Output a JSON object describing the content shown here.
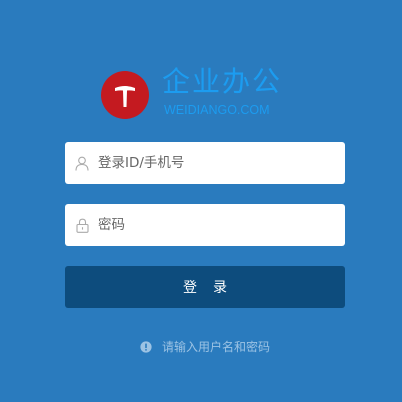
{
  "brand": {
    "title": "企业办公",
    "subtitle": "WEIDIANGO.COM",
    "logo_icon": "t-logo-icon",
    "logo_color": "#c41a20",
    "title_color": "#1c9cf0"
  },
  "form": {
    "username": {
      "placeholder": "登录ID/手机号",
      "value": "",
      "icon": "user-icon"
    },
    "password": {
      "placeholder": "密码",
      "value": "",
      "icon": "lock-icon"
    },
    "submit_label": "登录"
  },
  "hint": {
    "icon": "exclamation-circle-icon",
    "text": "请输入用户名和密码"
  },
  "colors": {
    "background": "#2a7bbe",
    "button": "#0d4c7d",
    "hint_text": "#9cc3e4"
  }
}
